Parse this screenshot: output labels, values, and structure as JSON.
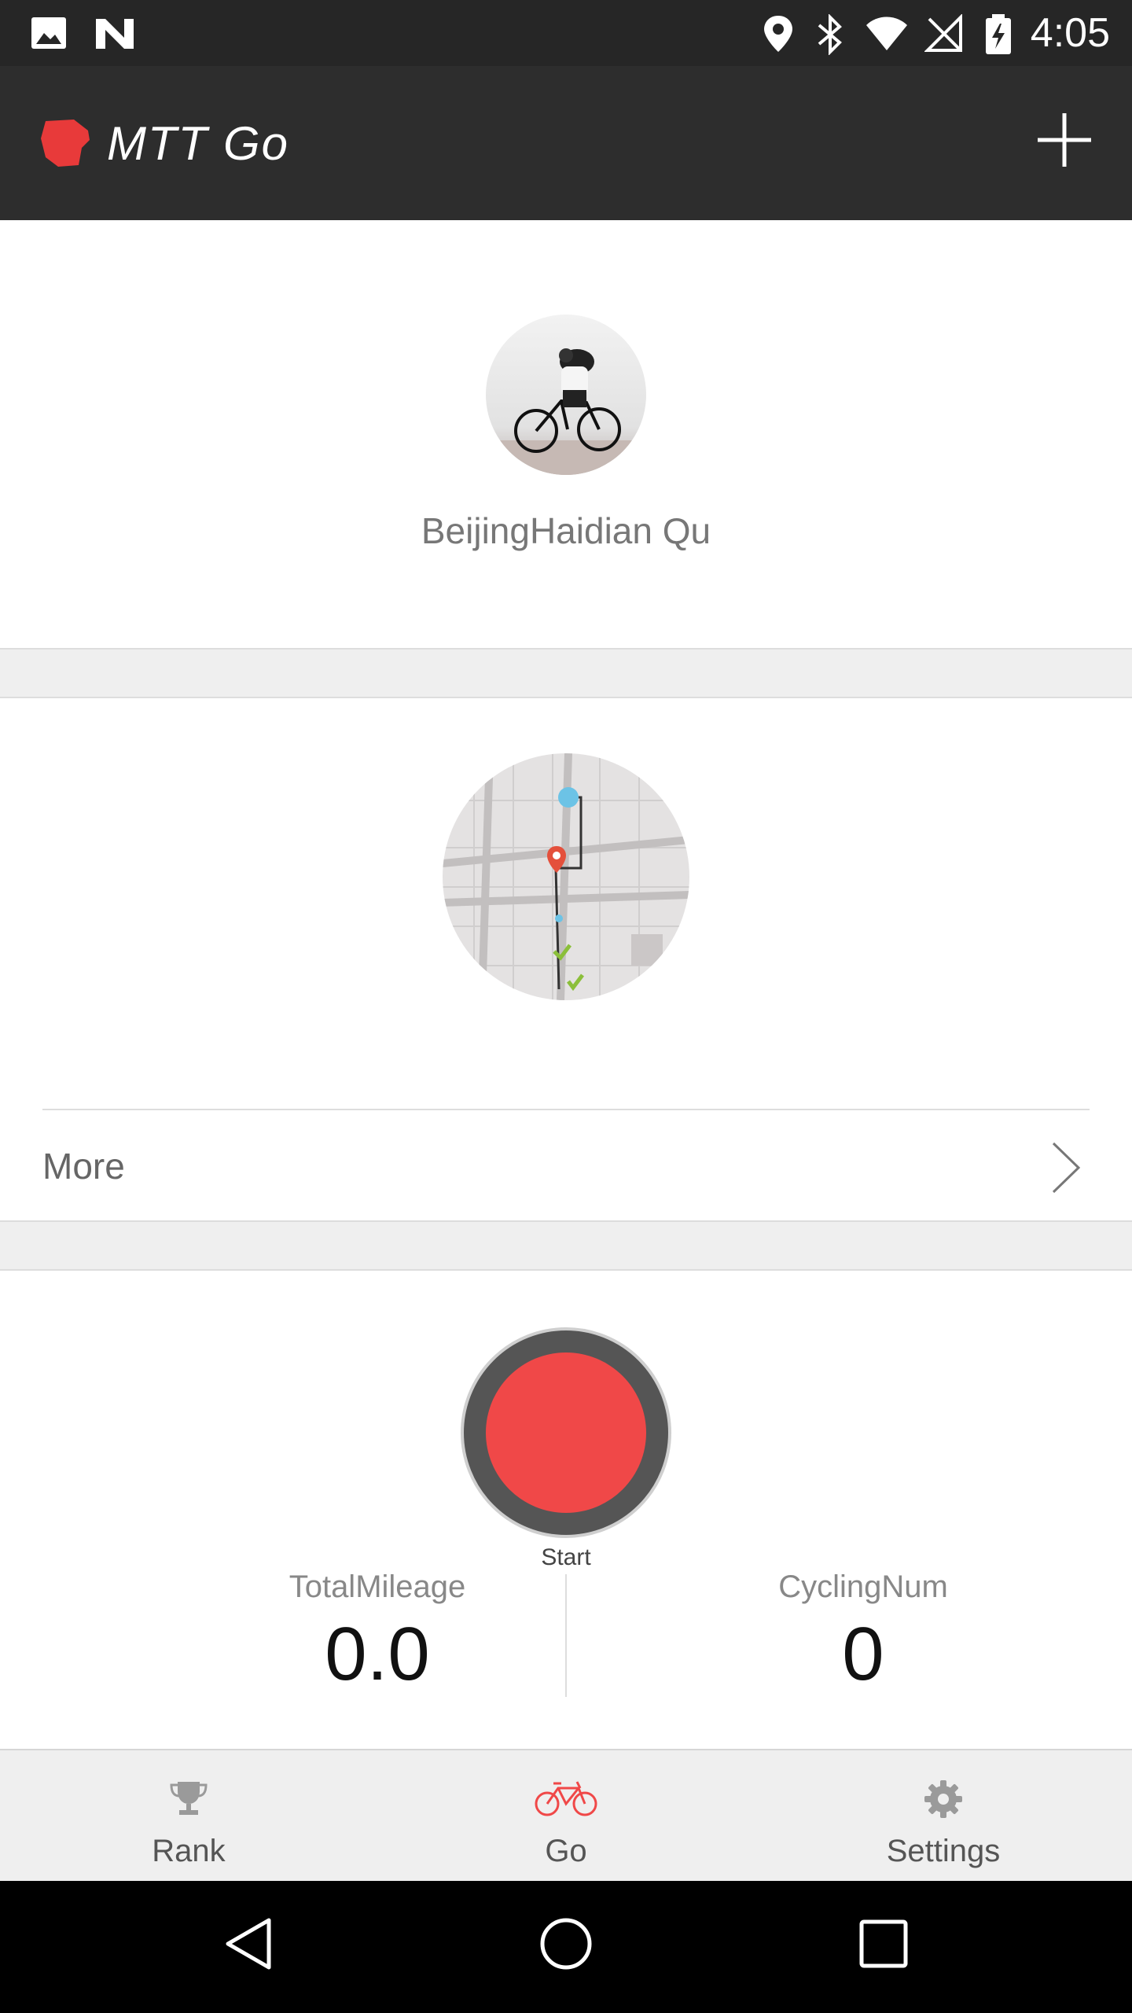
{
  "status_bar": {
    "time": "4:05",
    "icons": [
      "image-icon",
      "n-icon",
      "location-icon",
      "bluetooth-icon",
      "wifi-icon",
      "no-signal-icon",
      "battery-charging-icon"
    ]
  },
  "app_bar": {
    "title": "MTT Go",
    "add_icon": "plus-icon"
  },
  "profile": {
    "location": "BeijingHaidian Qu"
  },
  "map_card": {
    "more_label": "More"
  },
  "ride": {
    "start_label": "Start",
    "total_mileage_label": "TotalMileage",
    "total_mileage_value": "0.0",
    "cycling_num_label": "CyclingNum",
    "cycling_num_value": "0"
  },
  "bottom_nav": {
    "items": [
      {
        "label": "Rank",
        "icon": "trophy-icon",
        "active": false
      },
      {
        "label": "Go",
        "icon": "bicycle-icon",
        "active": true
      },
      {
        "label": "Settings",
        "icon": "gear-icon",
        "active": false
      }
    ]
  },
  "colors": {
    "accent": "#f04848",
    "app_bar": "#2d2d2d",
    "status_bar": "#262626"
  }
}
